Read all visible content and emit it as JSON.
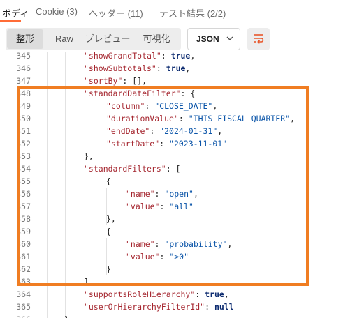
{
  "tabs": [
    {
      "label": "ボディ"
    },
    {
      "label": "Cookie (3)"
    },
    {
      "label": "ヘッダー (11)"
    },
    {
      "label": "テスト結果 (2/2)"
    }
  ],
  "view_modes": [
    "整形",
    "Raw",
    "プレビュー",
    "可視化"
  ],
  "active_view": "整形",
  "format_select": {
    "value": "JSON"
  },
  "icons": {
    "format": "chevron-down-icon",
    "wrap": "wrap-lines-icon"
  },
  "colors": {
    "accent": "#ff6c37",
    "highlight_box": "#f07d22",
    "key": "#a5262f",
    "string": "#0a54a8",
    "boolean": "#0b2a6f"
  },
  "code_lines": [
    {
      "n": "345",
      "segs": [
        {
          "t": "\"showGrandTotal\"",
          "c": "k"
        },
        {
          "t": ": ",
          "c": "p"
        },
        {
          "t": "true",
          "c": "b"
        },
        {
          "t": ",",
          "c": "p"
        }
      ]
    },
    {
      "n": "346",
      "segs": [
        {
          "t": "\"showSubtotals\"",
          "c": "k"
        },
        {
          "t": ": ",
          "c": "p"
        },
        {
          "t": "true",
          "c": "b"
        },
        {
          "t": ",",
          "c": "p"
        }
      ]
    },
    {
      "n": "347",
      "segs": [
        {
          "t": "\"sortBy\"",
          "c": "k"
        },
        {
          "t": ": [],",
          "c": "p"
        }
      ]
    },
    {
      "n": "348",
      "segs": [
        {
          "t": "\"standardDateFilter\"",
          "c": "k"
        },
        {
          "t": ": {",
          "c": "p"
        }
      ]
    },
    {
      "n": "349",
      "segs": [
        {
          "t": "\"column\"",
          "c": "k"
        },
        {
          "t": ": ",
          "c": "p"
        },
        {
          "t": "\"CLOSE_DATE\"",
          "c": "s"
        },
        {
          "t": ",",
          "c": "p"
        }
      ]
    },
    {
      "n": "350",
      "segs": [
        {
          "t": "\"durationValue\"",
          "c": "k"
        },
        {
          "t": ": ",
          "c": "p"
        },
        {
          "t": "\"THIS_FISCAL_QUARTER\"",
          "c": "s"
        },
        {
          "t": ",",
          "c": "p"
        }
      ]
    },
    {
      "n": "351",
      "segs": [
        {
          "t": "\"endDate\"",
          "c": "k"
        },
        {
          "t": ": ",
          "c": "p"
        },
        {
          "t": "\"2024-01-31\"",
          "c": "s"
        },
        {
          "t": ",",
          "c": "p"
        }
      ]
    },
    {
      "n": "352",
      "segs": [
        {
          "t": "\"startDate\"",
          "c": "k"
        },
        {
          "t": ": ",
          "c": "p"
        },
        {
          "t": "\"2023-11-01\"",
          "c": "s"
        }
      ]
    },
    {
      "n": "353",
      "segs": [
        {
          "t": "},",
          "c": "p"
        }
      ]
    },
    {
      "n": "354",
      "segs": [
        {
          "t": "\"standardFilters\"",
          "c": "k"
        },
        {
          "t": ": [",
          "c": "p"
        }
      ]
    },
    {
      "n": "355",
      "segs": [
        {
          "t": "{",
          "c": "p"
        }
      ]
    },
    {
      "n": "356",
      "segs": [
        {
          "t": "\"name\"",
          "c": "k"
        },
        {
          "t": ": ",
          "c": "p"
        },
        {
          "t": "\"open\"",
          "c": "s"
        },
        {
          "t": ",",
          "c": "p"
        }
      ]
    },
    {
      "n": "357",
      "segs": [
        {
          "t": "\"value\"",
          "c": "k"
        },
        {
          "t": ": ",
          "c": "p"
        },
        {
          "t": "\"all\"",
          "c": "s"
        }
      ]
    },
    {
      "n": "358",
      "segs": [
        {
          "t": "},",
          "c": "p"
        }
      ]
    },
    {
      "n": "359",
      "segs": [
        {
          "t": "{",
          "c": "p"
        }
      ]
    },
    {
      "n": "360",
      "segs": [
        {
          "t": "\"name\"",
          "c": "k"
        },
        {
          "t": ": ",
          "c": "p"
        },
        {
          "t": "\"probability\"",
          "c": "s"
        },
        {
          "t": ",",
          "c": "p"
        }
      ]
    },
    {
      "n": "361",
      "segs": [
        {
          "t": "\"value\"",
          "c": "k"
        },
        {
          "t": ": ",
          "c": "p"
        },
        {
          "t": "\">0\"",
          "c": "s"
        }
      ]
    },
    {
      "n": "362",
      "segs": [
        {
          "t": "}",
          "c": "p"
        }
      ]
    },
    {
      "n": "363",
      "segs": [
        {
          "t": "],",
          "c": "p"
        }
      ]
    },
    {
      "n": "364",
      "segs": [
        {
          "t": "\"supportsRoleHierarchy\"",
          "c": "k"
        },
        {
          "t": ": ",
          "c": "p"
        },
        {
          "t": "true",
          "c": "b"
        },
        {
          "t": ",",
          "c": "p"
        }
      ]
    },
    {
      "n": "365",
      "segs": [
        {
          "t": "\"userOrHierarchyFilterId\"",
          "c": "k"
        },
        {
          "t": ": ",
          "c": "p"
        },
        {
          "t": "null",
          "c": "b"
        }
      ]
    },
    {
      "n": "366",
      "segs": [
        {
          "t": "}",
          "c": "p"
        }
      ]
    }
  ]
}
